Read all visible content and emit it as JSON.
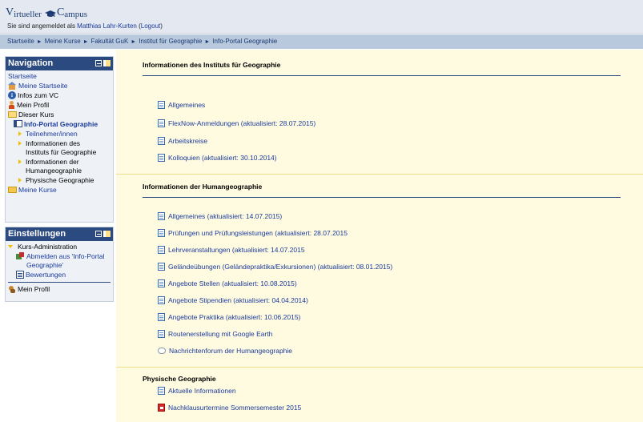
{
  "header": {
    "logo_first": "V",
    "logo_word1": "irtueller",
    "logo_second": "C",
    "logo_word2": "ampus",
    "login_prefix": "Sie sind angemeldet als ",
    "user_name": "Matthias Lahr-Kurten",
    "logout_open": " (",
    "logout_label": "Logout",
    "logout_close": ")"
  },
  "breadcrumb": {
    "items": [
      "Startseite",
      "Meine Kurse",
      "Fakultät GuK",
      "Institut für Geographie",
      "Info-Portal Geographie"
    ],
    "separator": "►"
  },
  "navigation": {
    "title": "Navigation",
    "startseite": "Startseite",
    "meine_startseite": "Meine Startseite",
    "infos_vc": "Infos zum VC",
    "mein_profil": "Mein Profil",
    "dieser_kurs": "Dieser Kurs",
    "current_course": "Info-Portal Geographie",
    "teilnehmer": "Teilnehmer/innen",
    "inst_line1": "Informationen des",
    "inst_line2": "Instituts für Geographie",
    "human_line1": "Informationen der",
    "human_line2": "Humangeographie",
    "physisch": "Physische Geographie",
    "meine_kurse": "Meine Kurse"
  },
  "einstellungen": {
    "title": "Einstellungen",
    "kurs_admin": "Kurs-Administration",
    "abmelden_line1": "Abmelden aus 'Info-Portal",
    "abmelden_line2": "Geographie'",
    "bewertungen": "Bewertungen",
    "mein_profil": "Mein Profil"
  },
  "sections": {
    "institut": {
      "title": "Informationen des Instituts für Geographie",
      "items": [
        "Allgemeines",
        "FlexNow-Anmeldungen (aktualisiert: 28.07.2015)",
        "Arbeitskreise",
        "Kolloquien (aktualisiert: 30.10.2014)"
      ]
    },
    "human": {
      "title": "Informationen der Humangeographie",
      "items": [
        "Allgemeines (aktualisiert: 14.07.2015)",
        "Prüfungen und Prüfungsleistungen (aktualisiert: 28.07.2015",
        "Lehrveranstaltungen (aktualisiert: 14.07.2015",
        "Geländeübungen (Geländepraktika/Exkursionen) (aktualisiert: 08.01.2015)",
        "Angebote Stellen (aktualisiert: 10.08.2015)",
        "Angebote Stipendien (aktualisiert: 04.04.2014)",
        "Angebote Praktika (aktualisiert: 10.06.2015)",
        "Routenerstellung mit Google Earth",
        "Nachrichtenforum der Humangeographie"
      ]
    },
    "physisch": {
      "title": "Physische Geographie",
      "items": [
        "Aktuelle Informationen",
        "Nachklausurtermine Sommersemester 2015"
      ]
    }
  }
}
